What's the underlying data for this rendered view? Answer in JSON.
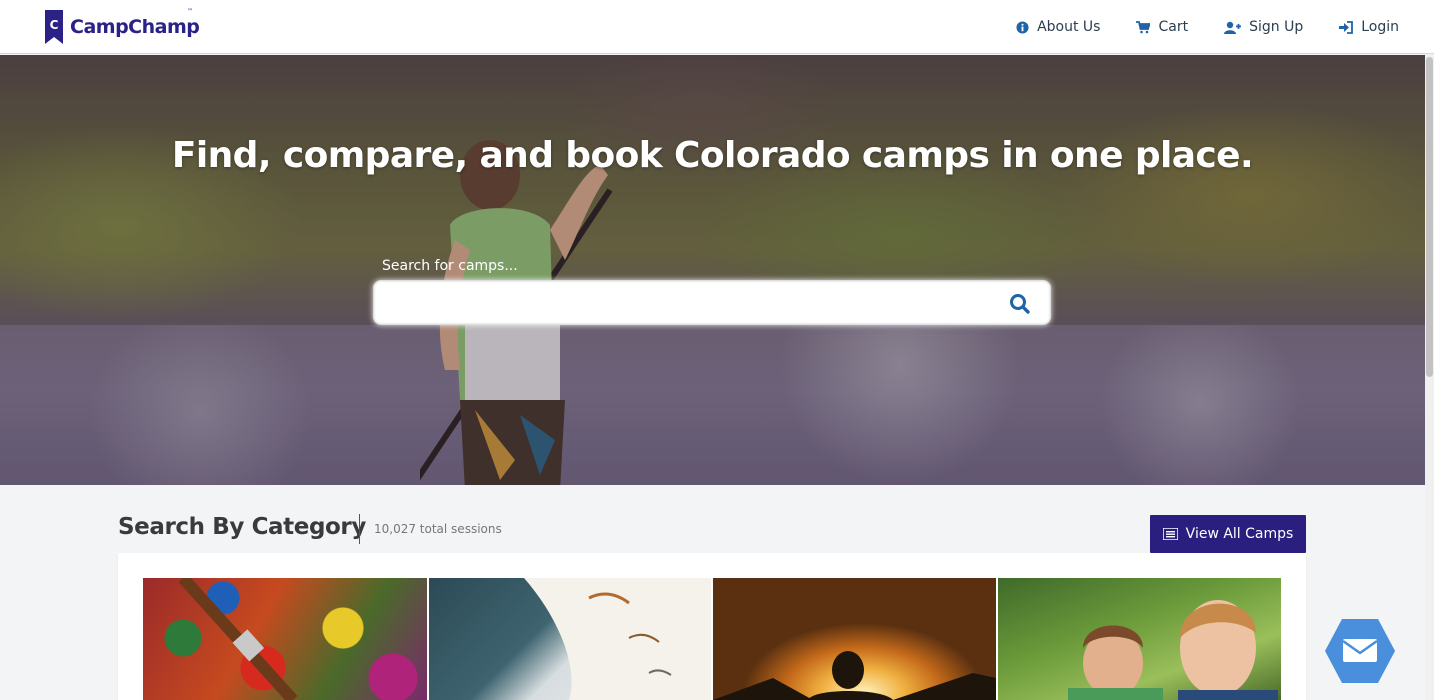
{
  "brand": {
    "name": "CampChamp",
    "tm": "™",
    "letter": "C",
    "color": "#2a2286"
  },
  "nav": {
    "items": [
      {
        "label": "About Us",
        "icon": "info-icon"
      },
      {
        "label": "Cart",
        "icon": "cart-icon"
      },
      {
        "label": "Sign Up",
        "icon": "user-plus-icon"
      },
      {
        "label": "Login",
        "icon": "sign-in-icon"
      }
    ]
  },
  "hero": {
    "title": "Find, compare, and book Colorado camps in one place.",
    "search_label": "Search for camps...",
    "search_value": ""
  },
  "categories": {
    "title": "Search By Category",
    "count": "10,027 total sessions",
    "view_all_label": "View All Camps",
    "accent": "#2a1f7e",
    "tiles": [
      {
        "image": "paint-palette-photo"
      },
      {
        "image": "book-reading-photo"
      },
      {
        "image": "sunset-silhouette-photo"
      },
      {
        "image": "kids-outdoors-photo"
      }
    ]
  },
  "colors": {
    "nav_icon": "#1f63a8",
    "chat": "#4a8fdc"
  }
}
